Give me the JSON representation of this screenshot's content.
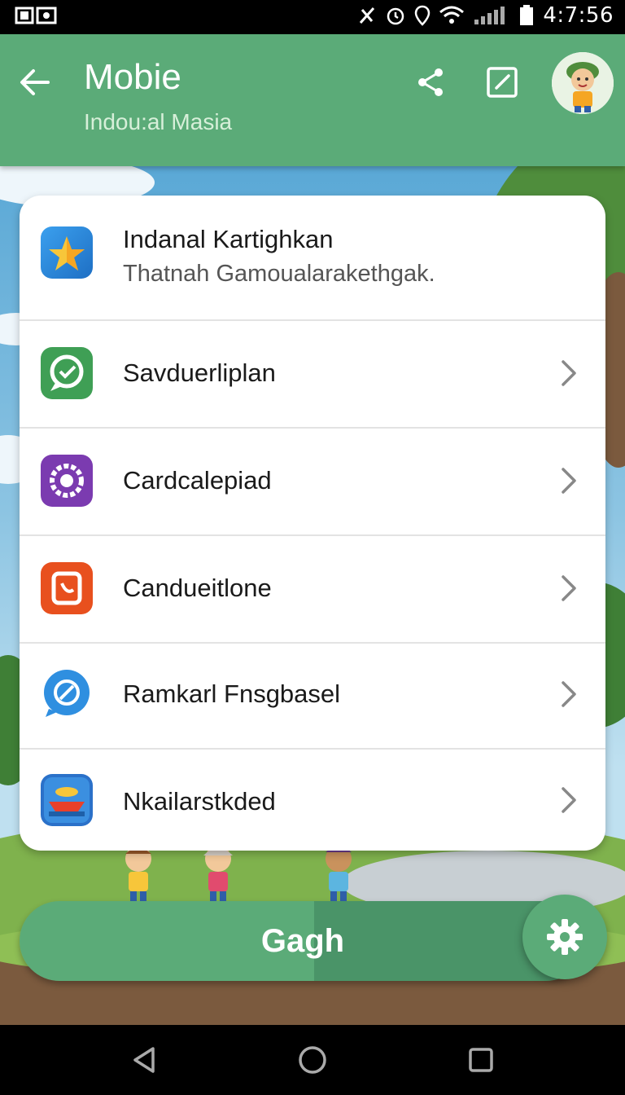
{
  "status_bar": {
    "time": "4:7:56",
    "left_glyphs": "◫ ⊡"
  },
  "app_bar": {
    "title": "Mobie",
    "subtitle": "Indou:al Masia"
  },
  "list": {
    "header": {
      "title": "Indanal Kartighkan",
      "subtitle": "Thatnah Gamoualaraketh­gak."
    },
    "items": [
      {
        "label": "Savduerliplan",
        "icon": "chat-bubble-icon",
        "color": "#3f9f55"
      },
      {
        "label": "Cardcalepiad",
        "icon": "gear-ring-icon",
        "color": "#7b3bb0"
      },
      {
        "label": "Candueitlone",
        "icon": "phone-card-icon",
        "color": "#e8501e"
      },
      {
        "label": "Ramkarl Fnsgbasel",
        "icon": "compass-bubble-icon",
        "color": "#2f8fe0"
      },
      {
        "label": "Nkailarstkded",
        "icon": "boat-icon",
        "color": "#2b71c9"
      }
    ]
  },
  "bottom_button": {
    "label": "Gagh"
  },
  "colors": {
    "accent": "#5bab78",
    "accent_dark": "#4a9468"
  }
}
